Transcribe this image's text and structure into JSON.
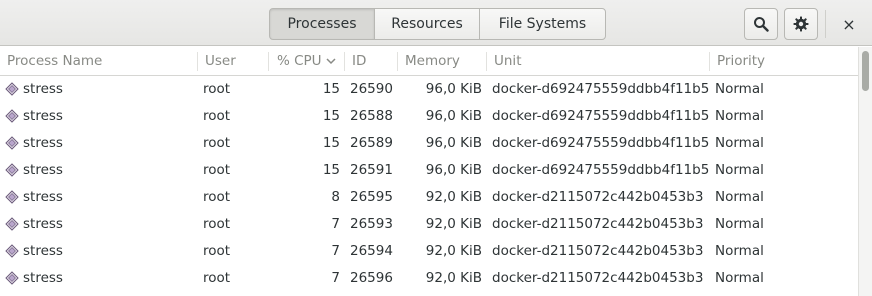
{
  "tabs": [
    {
      "label": "Processes",
      "active": true
    },
    {
      "label": "Resources",
      "active": false
    },
    {
      "label": "File Systems",
      "active": false
    }
  ],
  "toolbar": {
    "search_icon": "search-icon",
    "menu_icon": "gear-icon",
    "close_label": "×"
  },
  "columns": {
    "name": "Process Name",
    "user": "User",
    "cpu": "% CPU",
    "id": "ID",
    "memory": "Memory",
    "unit": "Unit",
    "priority": "Priority"
  },
  "rows": [
    {
      "name": "stress",
      "user": "root",
      "cpu": "15",
      "id": "26590",
      "memory": "96,0 KiB",
      "unit": "docker-d692475559ddbb4f11b5",
      "priority": "Normal"
    },
    {
      "name": "stress",
      "user": "root",
      "cpu": "15",
      "id": "26588",
      "memory": "96,0 KiB",
      "unit": "docker-d692475559ddbb4f11b5",
      "priority": "Normal"
    },
    {
      "name": "stress",
      "user": "root",
      "cpu": "15",
      "id": "26589",
      "memory": "96,0 KiB",
      "unit": "docker-d692475559ddbb4f11b5",
      "priority": "Normal"
    },
    {
      "name": "stress",
      "user": "root",
      "cpu": "15",
      "id": "26591",
      "memory": "96,0 KiB",
      "unit": "docker-d692475559ddbb4f11b5",
      "priority": "Normal"
    },
    {
      "name": "stress",
      "user": "root",
      "cpu": "8",
      "id": "26595",
      "memory": "92,0 KiB",
      "unit": "docker-d2115072c442b0453b3",
      "priority": "Normal"
    },
    {
      "name": "stress",
      "user": "root",
      "cpu": "7",
      "id": "26593",
      "memory": "92,0 KiB",
      "unit": "docker-d2115072c442b0453b3",
      "priority": "Normal"
    },
    {
      "name": "stress",
      "user": "root",
      "cpu": "7",
      "id": "26594",
      "memory": "92,0 KiB",
      "unit": "docker-d2115072c442b0453b3",
      "priority": "Normal"
    },
    {
      "name": "stress",
      "user": "root",
      "cpu": "7",
      "id": "26596",
      "memory": "92,0 KiB",
      "unit": "docker-d2115072c442b0453b3",
      "priority": "Normal"
    }
  ],
  "colors": {
    "header_bg": "#e8e8e7",
    "active_tab": "#d8d8d5",
    "column_header_text": "#888a85",
    "text": "#2e3436"
  }
}
